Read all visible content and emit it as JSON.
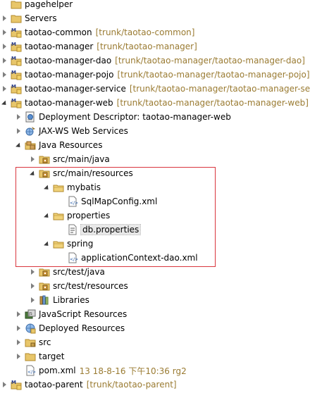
{
  "colors": {
    "decoration": "#9a7b32",
    "highlight_box": "#d9363e"
  },
  "tree": [
    {
      "label": "pagehelper",
      "decoration": "",
      "icon": "folder-icon",
      "twisty": "none"
    },
    {
      "label": "Servers",
      "decoration": "",
      "icon": "folder-icon",
      "twisty": "closed"
    },
    {
      "label": "taotao-common",
      "decoration": "[trunk/taotao-common]",
      "icon": "maven-project-icon",
      "twisty": "closed"
    },
    {
      "label": "taotao-manager",
      "decoration": "[trunk/taotao-manager]",
      "icon": "maven-project-icon",
      "twisty": "closed"
    },
    {
      "label": "taotao-manager-dao",
      "decoration": "[trunk/taotao-manager/taotao-manager-dao]",
      "icon": "maven-project-icon",
      "twisty": "closed"
    },
    {
      "label": "taotao-manager-pojo",
      "decoration": "[trunk/taotao-manager/taotao-manager-pojo]",
      "icon": "maven-project-icon",
      "twisty": "closed"
    },
    {
      "label": "taotao-manager-service",
      "decoration": "[trunk/taotao-manager/taotao-manager-serv",
      "icon": "maven-project-icon",
      "twisty": "closed"
    },
    {
      "label": "taotao-manager-web",
      "decoration": "[trunk/taotao-manager/taotao-manager-web]",
      "icon": "maven-project-icon",
      "twisty": "open"
    },
    {
      "label": "Deployment Descriptor: taotao-manager-web",
      "decoration": "",
      "icon": "deployment-descriptor-icon",
      "twisty": "closed"
    },
    {
      "label": "JAX-WS Web Services",
      "decoration": "",
      "icon": "web-services-icon",
      "twisty": "closed"
    },
    {
      "label": "Java Resources",
      "decoration": "",
      "icon": "java-resources-icon",
      "twisty": "open"
    },
    {
      "label": "src/main/java",
      "decoration": "",
      "icon": "source-folder-icon",
      "twisty": "closed"
    },
    {
      "label": "src/main/resources",
      "decoration": "",
      "icon": "source-folder-icon",
      "twisty": "open"
    },
    {
      "label": "mybatis",
      "decoration": "",
      "icon": "package-folder-icon",
      "twisty": "open"
    },
    {
      "label": "SqlMapConfig.xml",
      "decoration": "",
      "icon": "xml-file-icon",
      "twisty": "none"
    },
    {
      "label": "properties",
      "decoration": "",
      "icon": "package-folder-icon",
      "twisty": "open"
    },
    {
      "label": "db.properties",
      "decoration": "",
      "icon": "properties-file-icon",
      "twisty": "none"
    },
    {
      "label": "spring",
      "decoration": "",
      "icon": "package-folder-icon",
      "twisty": "open"
    },
    {
      "label": "applicationContext-dao.xml",
      "decoration": "",
      "icon": "xml-file-icon",
      "twisty": "none"
    },
    {
      "label": "src/test/java",
      "decoration": "",
      "icon": "source-folder-icon",
      "twisty": "closed"
    },
    {
      "label": "src/test/resources",
      "decoration": "",
      "icon": "source-folder-icon",
      "twisty": "closed"
    },
    {
      "label": "Libraries",
      "decoration": "",
      "icon": "libraries-icon",
      "twisty": "closed"
    },
    {
      "label": "JavaScript Resources",
      "decoration": "",
      "icon": "javascript-resources-icon",
      "twisty": "closed"
    },
    {
      "label": "Deployed Resources",
      "decoration": "",
      "icon": "deployed-resources-icon",
      "twisty": "closed"
    },
    {
      "label": "src",
      "decoration": "",
      "icon": "folder-icon",
      "twisty": "closed"
    },
    {
      "label": "target",
      "decoration": "",
      "icon": "folder-icon",
      "twisty": "closed"
    },
    {
      "label": "pom.xml",
      "decoration": "13   18-8-16 下午10:36   rg2",
      "icon": "xml-file-icon",
      "twisty": "none"
    },
    {
      "label": "taotao-parent",
      "decoration": "[trunk/taotao-parent]",
      "icon": "maven-project-icon",
      "twisty": "closed"
    }
  ]
}
